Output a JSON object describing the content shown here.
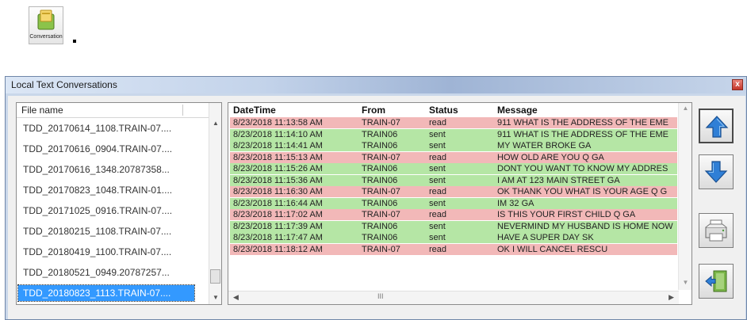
{
  "desktop_icon": {
    "label": "Conversation",
    "icon": "conversation-folder-icon"
  },
  "window": {
    "title": "Local Text Conversations",
    "close_label": "x"
  },
  "file_list": {
    "header": "File name",
    "items": [
      "TDD_20170614_1108.TRAIN-07....",
      "TDD_20170616_0904.TRAIN-07....",
      "TDD_20170616_1348.20787358...",
      "TDD_20170823_1048.TRAIN-01....",
      "TDD_20171025_0916.TRAIN-07....",
      "TDD_20180215_1108.TRAIN-07....",
      "TDD_20180419_1100.TRAIN-07....",
      "TDD_20180521_0949.20787257...",
      "TDD_20180823_1113.TRAIN-07...."
    ],
    "selected_index": 8
  },
  "messages": {
    "columns": [
      "DateTime",
      "From",
      "Status",
      "Message"
    ],
    "rows": [
      {
        "datetime": "8/23/2018 11:13:58 AM",
        "from": "TRAIN-07",
        "status": "read",
        "message": "911 WHAT IS THE ADDRESS OF THE EME"
      },
      {
        "datetime": "8/23/2018 11:14:10 AM",
        "from": "TRAIN06",
        "status": "sent",
        "message": "911 WHAT IS THE ADDRESS OF THE EME"
      },
      {
        "datetime": "8/23/2018 11:14:41 AM",
        "from": "TRAIN06",
        "status": "sent",
        "message": "MY WATER BROKE GA"
      },
      {
        "datetime": "8/23/2018 11:15:13 AM",
        "from": "TRAIN-07",
        "status": "read",
        "message": "HOW OLD ARE YOU Q GA"
      },
      {
        "datetime": "8/23/2018 11:15:26 AM",
        "from": "TRAIN06",
        "status": "sent",
        "message": "DONT YOU WANT TO KNOW MY ADDRES"
      },
      {
        "datetime": "8/23/2018 11:15:36 AM",
        "from": "TRAIN06",
        "status": "sent",
        "message": "I AM AT 123 MAIN STREET GA"
      },
      {
        "datetime": "8/23/2018 11:16:30 AM",
        "from": "TRAIN-07",
        "status": "read",
        "message": "OK THANK YOU WHAT IS YOUR AGE Q G"
      },
      {
        "datetime": "8/23/2018 11:16:44 AM",
        "from": "TRAIN06",
        "status": "sent",
        "message": "IM 32 GA"
      },
      {
        "datetime": "8/23/2018 11:17:02 AM",
        "from": "TRAIN-07",
        "status": "read",
        "message": "IS THIS YOUR FIRST CHILD Q GA"
      },
      {
        "datetime": "8/23/2018 11:17:39 AM",
        "from": "TRAIN06",
        "status": "sent",
        "message": "NEVERMIND MY HUSBAND IS HOME NOW"
      },
      {
        "datetime": "8/23/2018 11:17:47 AM",
        "from": "TRAIN06",
        "status": "sent",
        "message": "HAVE A SUPER DAY SK"
      },
      {
        "datetime": "8/23/2018 11:18:12 AM",
        "from": "TRAIN-07",
        "status": "read",
        "message": "OK I WILL CANCEL RESCU"
      }
    ],
    "hscroll_grip": "III"
  },
  "side_buttons": [
    {
      "name": "scroll-up-button",
      "icon": "arrow-up-icon"
    },
    {
      "name": "scroll-down-button",
      "icon": "arrow-down-icon"
    },
    {
      "name": "print-button",
      "icon": "printer-icon"
    },
    {
      "name": "exit-button",
      "icon": "exit-door-icon"
    }
  ],
  "colors": {
    "read_row": "#f2b8b8",
    "sent_row": "#b5e6a5",
    "selection": "#3399ff",
    "arrow_blue": "#2f7fd6"
  }
}
